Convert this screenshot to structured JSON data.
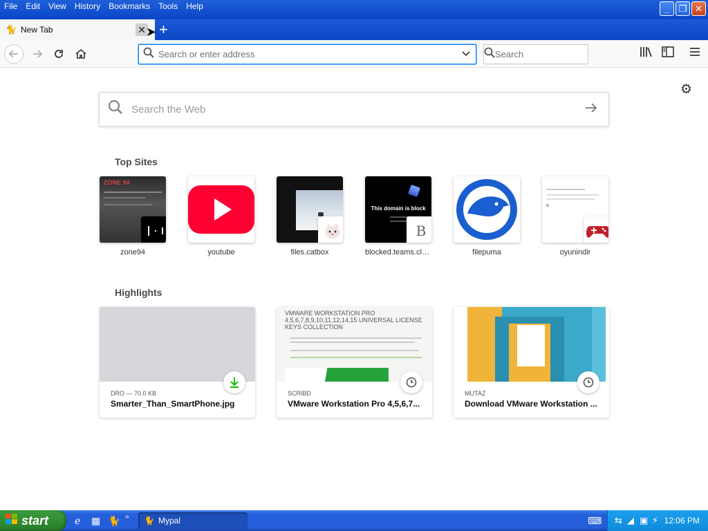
{
  "menu": [
    "File",
    "Edit",
    "View",
    "History",
    "Bookmarks",
    "Tools",
    "Help"
  ],
  "window_buttons": {
    "minimize": "_",
    "maximize": "❐",
    "close": "✕"
  },
  "tab": {
    "title": "New Tab",
    "close": "✕",
    "new_tab": "+"
  },
  "navbar": {
    "url_placeholder": "Search or enter address",
    "search_placeholder": "Search"
  },
  "newtab": {
    "web_search_placeholder": "Search the Web",
    "top_sites_title": "Top Sites",
    "highlights_title": "Highlights",
    "top_sites": [
      {
        "label": "zone94"
      },
      {
        "label": "youtube"
      },
      {
        "label": "files.catbox"
      },
      {
        "label": "blocked.teams.clo..."
      },
      {
        "label": "filepuma"
      },
      {
        "label": "oyunindir"
      }
    ],
    "highlights": [
      {
        "source": "DRO — 70.0 KB",
        "title": "Smarter_Than_SmartPhone.jpg",
        "badge": "download-icon"
      },
      {
        "source": "SCRIBD",
        "title": "VMware Workstation Pro 4,5,6,7...",
        "badge": "clock-icon",
        "thumb_text": "VMWARE WORKSTATION PRO 4,5,6,7,8,9,10,11,12,14,15 UNIVERSAL LICENSE KEYS COLLECTION"
      },
      {
        "source": "MUTAZ",
        "title": "Download VMware Workstation ...",
        "badge": "clock-icon"
      }
    ]
  },
  "taskbar": {
    "start_label": "start",
    "task_label": "Mypal",
    "clock": "12:06 PM"
  },
  "blocked_thumb_text": "This domain is block",
  "zone_thumb_text": "ZONE 94",
  "colors": {
    "accent": "#0a84ff",
    "xp_blue": "#245edb",
    "start_green": "#2f8a2f",
    "youtube_red": "#ff0033"
  }
}
